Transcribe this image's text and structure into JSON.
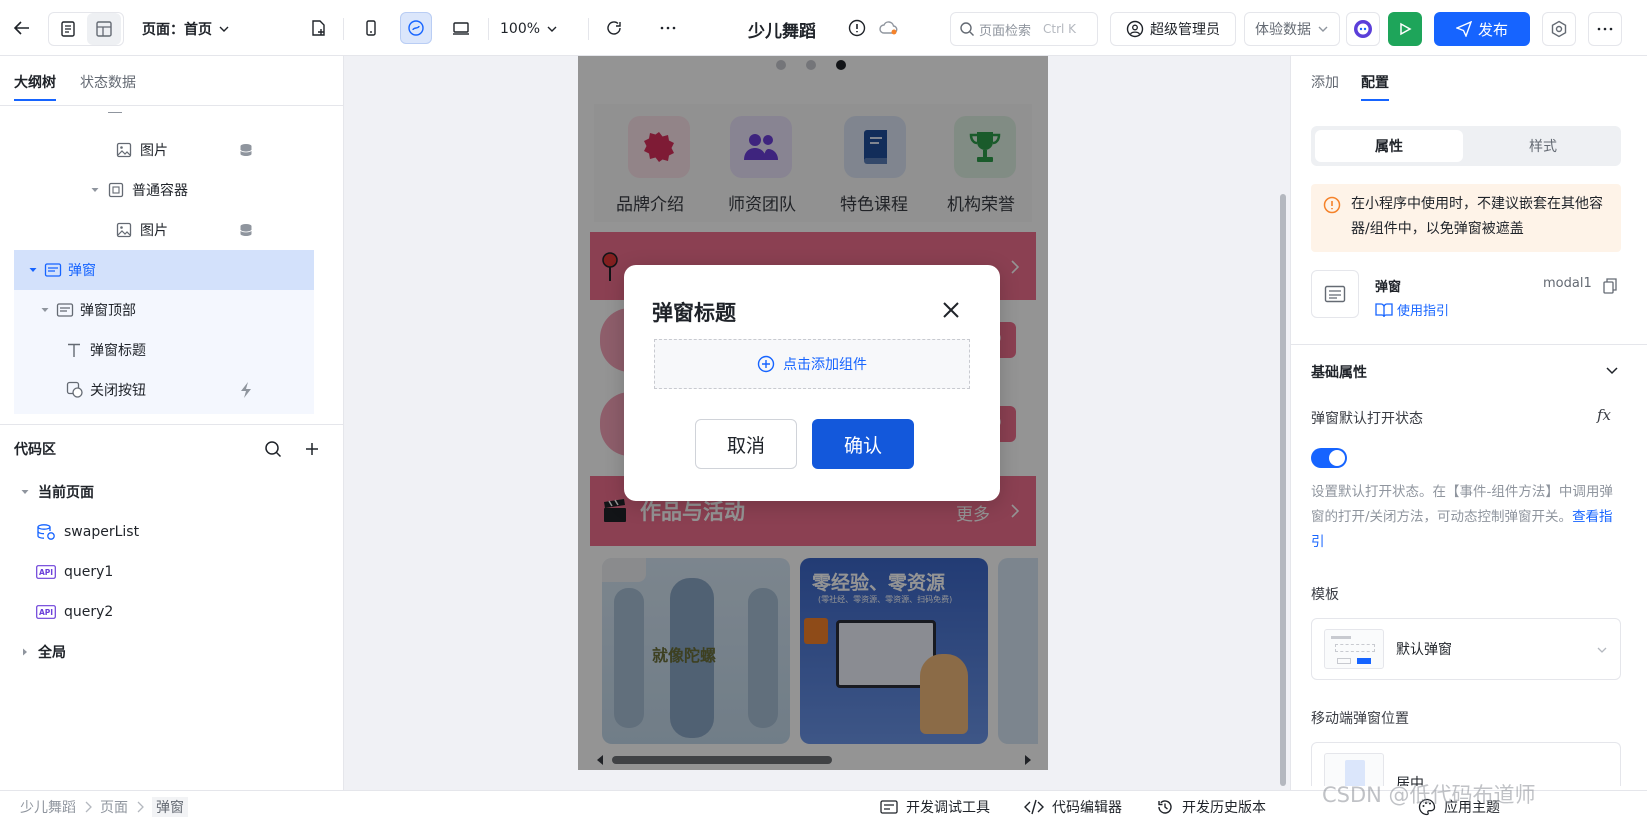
{
  "toolbar": {
    "page_select": "页面：首页",
    "zoom": "100%",
    "app_title": "少儿舞蹈",
    "search_placeholder": "页面检索",
    "search_shortcut": "Ctrl K",
    "admin_label": "超级管理员",
    "data_select": "体验数据",
    "publish_label": "发布"
  },
  "left_panel": {
    "tabs": [
      "大纲树",
      "状态数据"
    ],
    "tree": [
      {
        "label": "图片",
        "indent": 3,
        "icon": "image-icon",
        "action": "database-icon"
      },
      {
        "label": "普通容器",
        "indent": 2,
        "icon": "container-icon",
        "expand": true
      },
      {
        "label": "图片",
        "indent": 3,
        "icon": "image-icon",
        "action": "database-icon"
      },
      {
        "label": "弹窗",
        "indent": 0,
        "icon": "modal-icon",
        "expand": true,
        "selected": true
      },
      {
        "label": "弹窗顶部",
        "indent": 1,
        "icon": "modal-icon",
        "expand": true
      },
      {
        "label": "弹窗标题",
        "indent": 2,
        "icon": "text-icon"
      },
      {
        "label": "关闭按钮",
        "indent": 2,
        "icon": "button-icon",
        "action": "lightning-icon"
      }
    ],
    "code_title": "代码区",
    "code_groups": {
      "current": "当前页面",
      "items": [
        "swaperList",
        "query1",
        "query2"
      ],
      "global": "全局"
    }
  },
  "phone": {
    "nav": [
      "品牌介绍",
      "师资团队",
      "特色课程",
      "机构荣誉"
    ],
    "section_title": "作品与活动",
    "more_label": "更多",
    "poster_title": "零经验、零资源",
    "poster_sub": "(零社经、零资源、零资源、扫码免费)",
    "img_caption": "就像陀螺",
    "nav_colors": [
      "#d9305c",
      "#6b3fd9",
      "#1f4f9c",
      "#2e9e4a"
    ]
  },
  "modal": {
    "title": "弹窗标题",
    "add_component": "点击添加组件",
    "cancel": "取消",
    "confirm": "确认"
  },
  "right_panel": {
    "tabs": [
      "添加",
      "配置"
    ],
    "subtabs": [
      "属性",
      "样式"
    ],
    "warning": "在小程序中使用时，不建议嵌套在其他容器/组件中，以免弹窗被遮盖",
    "component_name": "弹窗",
    "component_id": "modal1",
    "guide_link": "使用指引",
    "basic_props": "基础属性",
    "open_state_label": "弹窗默认打开状态",
    "fx_label": "fx",
    "open_state_desc": "设置默认打开状态。在【事件-组件方法】中调用弹窗的打开/关闭方法，可动态控制弹窗开关。",
    "view_guide": "查看指引",
    "template_label": "模板",
    "template_value": "默认弹窗",
    "mobile_pos_label": "移动端弹窗位置",
    "mobile_pos_value": "居中",
    "toggle_on": true
  },
  "statusbar": {
    "breadcrumb": [
      "少儿舞蹈",
      "页面",
      "弹窗"
    ],
    "debug_tool": "开发调试工具",
    "code_editor": "代码编辑器",
    "history": "开发历史版本",
    "theme": "应用主题",
    "watermark": "CSDN @低代码布道师"
  },
  "colors": {
    "brand_blue": "#1664ff",
    "run_green": "#1ea55a",
    "section_pink": "#f06e8e"
  }
}
